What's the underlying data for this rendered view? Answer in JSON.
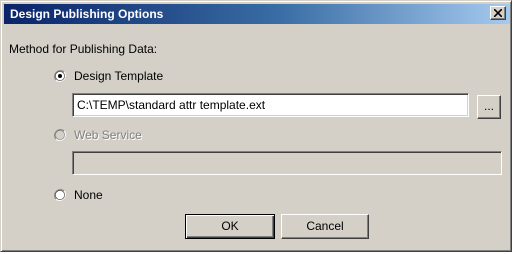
{
  "window": {
    "title": "Design Publishing Options",
    "close_icon": "close-icon"
  },
  "group_label": "Method for Publishing Data:",
  "options": {
    "design_template": {
      "label": "Design Template",
      "selected": true,
      "path_value": "C:\\TEMP\\standard attr template.ext",
      "browse_label": "..."
    },
    "web_service": {
      "label": "Web Service",
      "selected": false,
      "enabled": false,
      "url_value": ""
    },
    "none": {
      "label": "None",
      "selected": false
    }
  },
  "buttons": {
    "ok_label": "OK",
    "cancel_label": "Cancel"
  },
  "colors": {
    "title_gradient_start": "#0a246a",
    "title_gradient_end": "#a6caf0",
    "dialog_face": "#d4d0c8",
    "disabled_text": "#808080"
  }
}
